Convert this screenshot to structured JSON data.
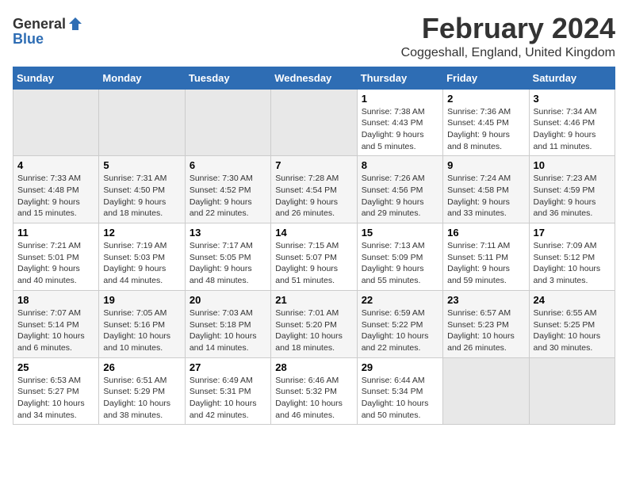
{
  "header": {
    "logo_general": "General",
    "logo_blue": "Blue",
    "title": "February 2024",
    "subtitle": "Coggeshall, England, United Kingdom"
  },
  "columns": [
    "Sunday",
    "Monday",
    "Tuesday",
    "Wednesday",
    "Thursday",
    "Friday",
    "Saturday"
  ],
  "weeks": [
    [
      {
        "day": "",
        "info": ""
      },
      {
        "day": "",
        "info": ""
      },
      {
        "day": "",
        "info": ""
      },
      {
        "day": "",
        "info": ""
      },
      {
        "day": "1",
        "info": "Sunrise: 7:38 AM\nSunset: 4:43 PM\nDaylight: 9 hours\nand 5 minutes."
      },
      {
        "day": "2",
        "info": "Sunrise: 7:36 AM\nSunset: 4:45 PM\nDaylight: 9 hours\nand 8 minutes."
      },
      {
        "day": "3",
        "info": "Sunrise: 7:34 AM\nSunset: 4:46 PM\nDaylight: 9 hours\nand 11 minutes."
      }
    ],
    [
      {
        "day": "4",
        "info": "Sunrise: 7:33 AM\nSunset: 4:48 PM\nDaylight: 9 hours\nand 15 minutes."
      },
      {
        "day": "5",
        "info": "Sunrise: 7:31 AM\nSunset: 4:50 PM\nDaylight: 9 hours\nand 18 minutes."
      },
      {
        "day": "6",
        "info": "Sunrise: 7:30 AM\nSunset: 4:52 PM\nDaylight: 9 hours\nand 22 minutes."
      },
      {
        "day": "7",
        "info": "Sunrise: 7:28 AM\nSunset: 4:54 PM\nDaylight: 9 hours\nand 26 minutes."
      },
      {
        "day": "8",
        "info": "Sunrise: 7:26 AM\nSunset: 4:56 PM\nDaylight: 9 hours\nand 29 minutes."
      },
      {
        "day": "9",
        "info": "Sunrise: 7:24 AM\nSunset: 4:58 PM\nDaylight: 9 hours\nand 33 minutes."
      },
      {
        "day": "10",
        "info": "Sunrise: 7:23 AM\nSunset: 4:59 PM\nDaylight: 9 hours\nand 36 minutes."
      }
    ],
    [
      {
        "day": "11",
        "info": "Sunrise: 7:21 AM\nSunset: 5:01 PM\nDaylight: 9 hours\nand 40 minutes."
      },
      {
        "day": "12",
        "info": "Sunrise: 7:19 AM\nSunset: 5:03 PM\nDaylight: 9 hours\nand 44 minutes."
      },
      {
        "day": "13",
        "info": "Sunrise: 7:17 AM\nSunset: 5:05 PM\nDaylight: 9 hours\nand 48 minutes."
      },
      {
        "day": "14",
        "info": "Sunrise: 7:15 AM\nSunset: 5:07 PM\nDaylight: 9 hours\nand 51 minutes."
      },
      {
        "day": "15",
        "info": "Sunrise: 7:13 AM\nSunset: 5:09 PM\nDaylight: 9 hours\nand 55 minutes."
      },
      {
        "day": "16",
        "info": "Sunrise: 7:11 AM\nSunset: 5:11 PM\nDaylight: 9 hours\nand 59 minutes."
      },
      {
        "day": "17",
        "info": "Sunrise: 7:09 AM\nSunset: 5:12 PM\nDaylight: 10 hours\nand 3 minutes."
      }
    ],
    [
      {
        "day": "18",
        "info": "Sunrise: 7:07 AM\nSunset: 5:14 PM\nDaylight: 10 hours\nand 6 minutes."
      },
      {
        "day": "19",
        "info": "Sunrise: 7:05 AM\nSunset: 5:16 PM\nDaylight: 10 hours\nand 10 minutes."
      },
      {
        "day": "20",
        "info": "Sunrise: 7:03 AM\nSunset: 5:18 PM\nDaylight: 10 hours\nand 14 minutes."
      },
      {
        "day": "21",
        "info": "Sunrise: 7:01 AM\nSunset: 5:20 PM\nDaylight: 10 hours\nand 18 minutes."
      },
      {
        "day": "22",
        "info": "Sunrise: 6:59 AM\nSunset: 5:22 PM\nDaylight: 10 hours\nand 22 minutes."
      },
      {
        "day": "23",
        "info": "Sunrise: 6:57 AM\nSunset: 5:23 PM\nDaylight: 10 hours\nand 26 minutes."
      },
      {
        "day": "24",
        "info": "Sunrise: 6:55 AM\nSunset: 5:25 PM\nDaylight: 10 hours\nand 30 minutes."
      }
    ],
    [
      {
        "day": "25",
        "info": "Sunrise: 6:53 AM\nSunset: 5:27 PM\nDaylight: 10 hours\nand 34 minutes."
      },
      {
        "day": "26",
        "info": "Sunrise: 6:51 AM\nSunset: 5:29 PM\nDaylight: 10 hours\nand 38 minutes."
      },
      {
        "day": "27",
        "info": "Sunrise: 6:49 AM\nSunset: 5:31 PM\nDaylight: 10 hours\nand 42 minutes."
      },
      {
        "day": "28",
        "info": "Sunrise: 6:46 AM\nSunset: 5:32 PM\nDaylight: 10 hours\nand 46 minutes."
      },
      {
        "day": "29",
        "info": "Sunrise: 6:44 AM\nSunset: 5:34 PM\nDaylight: 10 hours\nand 50 minutes."
      },
      {
        "day": "",
        "info": ""
      },
      {
        "day": "",
        "info": ""
      }
    ]
  ]
}
